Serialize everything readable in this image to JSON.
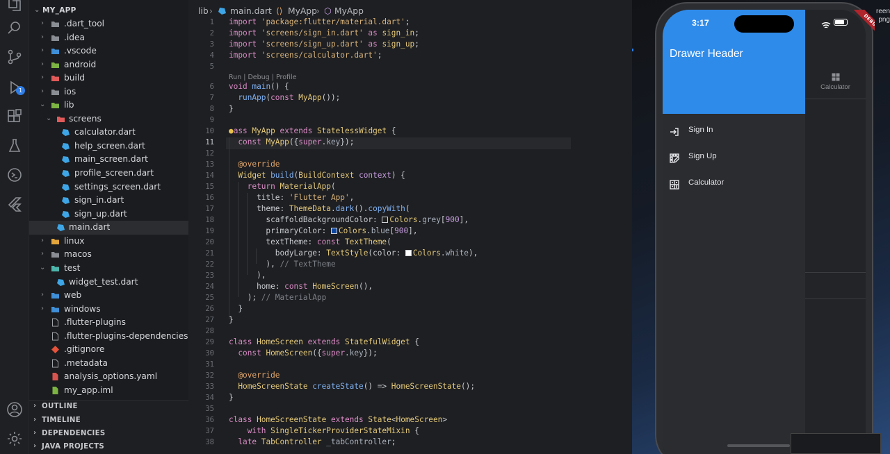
{
  "explorer": {
    "root": "MY_APP",
    "items": [
      {
        "label": ".dart_tool"
      },
      {
        "label": ".idea"
      },
      {
        "label": ".vscode"
      },
      {
        "label": "android"
      },
      {
        "label": "build"
      },
      {
        "label": "ios"
      },
      {
        "label": "lib"
      },
      {
        "label": "screens"
      },
      {
        "label": "calculator.dart"
      },
      {
        "label": "help_screen.dart"
      },
      {
        "label": "main_screen.dart"
      },
      {
        "label": "profile_screen.dart"
      },
      {
        "label": "settings_screen.dart"
      },
      {
        "label": "sign_in.dart"
      },
      {
        "label": "sign_up.dart"
      },
      {
        "label": "main.dart"
      },
      {
        "label": "linux"
      },
      {
        "label": "macos"
      },
      {
        "label": "test"
      },
      {
        "label": "widget_test.dart"
      },
      {
        "label": "web"
      },
      {
        "label": "windows"
      },
      {
        "label": ".flutter-plugins"
      },
      {
        "label": ".flutter-plugins-dependencies"
      },
      {
        "label": ".gitignore"
      },
      {
        "label": ".metadata"
      },
      {
        "label": "analysis_options.yaml"
      },
      {
        "label": "my_app.iml"
      }
    ],
    "sections": [
      "OUTLINE",
      "TIMELINE",
      "DEPENDENCIES",
      "JAVA PROJECTS"
    ]
  },
  "activity": {
    "debug_badge": "1"
  },
  "breadcrumbs": [
    "lib",
    "main.dart",
    "MyApp",
    "MyApp"
  ],
  "editor": {
    "codelens": "Run | Debug | Profile",
    "line_numbers": [
      "1",
      "2",
      "3",
      "4",
      "5",
      "6",
      "7",
      "8",
      "9",
      "10",
      "11",
      "12",
      "13",
      "14",
      "15",
      "16",
      "17",
      "18",
      "19",
      "20",
      "21",
      "22",
      "23",
      "24",
      "25",
      "26",
      "27",
      "28",
      "29",
      "30",
      "31",
      "32",
      "33",
      "34",
      "35",
      "36",
      "37",
      "38"
    ],
    "current_line": "11"
  },
  "phone": {
    "time": "3:17",
    "drawer_header": "Drawer Header",
    "drawer_items": [
      {
        "label": "Sign In",
        "icon": "login-icon"
      },
      {
        "label": "Sign Up",
        "icon": "app-registration-icon"
      },
      {
        "label": "Calculator",
        "icon": "calculate-icon"
      }
    ],
    "tab_label": "Calculator",
    "debug_banner": "DEBUG"
  },
  "desktop_file": {
    "line1": "reen",
    "line2": "png"
  },
  "colors": {
    "accent": "#2f7ee8",
    "drawer_header": "#2f8bea",
    "debug_banner": "#b0242b"
  }
}
